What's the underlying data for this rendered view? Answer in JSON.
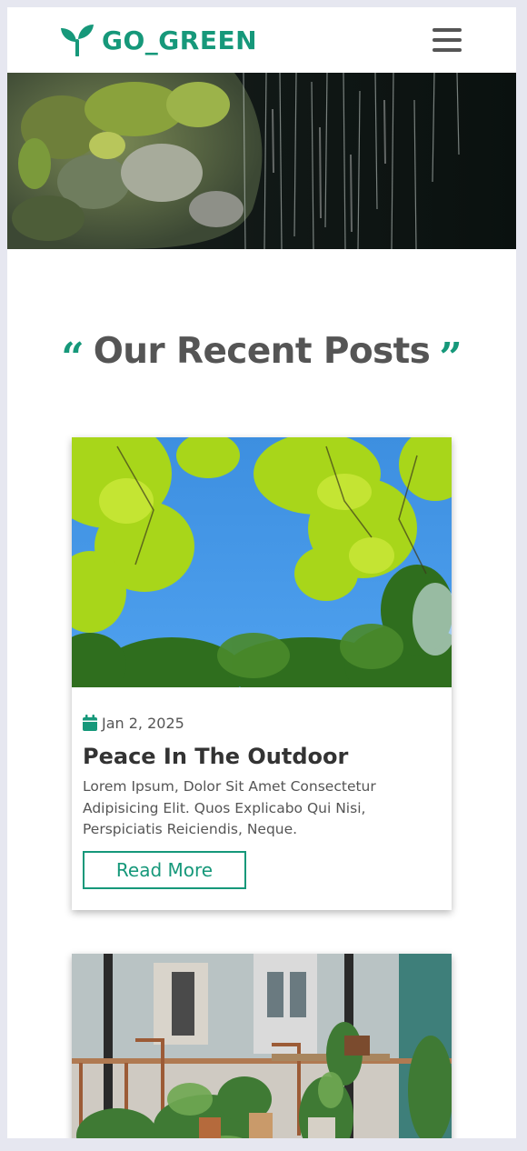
{
  "navbar": {
    "brand": "GO_GREEN",
    "brand_icon": "sprout-icon",
    "menu_icon": "hamburger-menu-icon"
  },
  "hero": {
    "image": "waterfall-over-mossy-rock"
  },
  "section": {
    "title": "Our Recent Posts",
    "open_quote": "“",
    "close_quote": "”"
  },
  "posts": [
    {
      "image": "tree-canopy-against-blue-sky",
      "date_icon": "calendar-icon",
      "date": "Jan 2, 2025",
      "title": "Peace In The Outdoor",
      "excerpt": "Lorem Ipsum, Dolor Sit Amet Consectetur Adipisicing Elit. Quos Explicabo Qui Nisi, Perspiciatis Reiciendis, Neque.",
      "button_label": "Read More"
    },
    {
      "image": "cafe-interior-with-potted-plants"
    }
  ],
  "colors": {
    "accent": "#16987a",
    "heading": "#555555",
    "page_background": "#e6e7f0"
  }
}
